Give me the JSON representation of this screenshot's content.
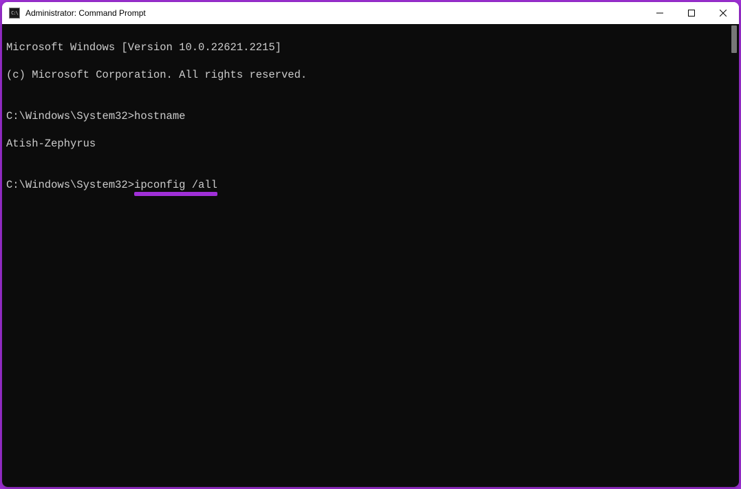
{
  "window": {
    "title": "Administrator: Command Prompt",
    "icon_text": "C:\\"
  },
  "terminal": {
    "lines": {
      "version": "Microsoft Windows [Version 10.0.22621.2215]",
      "copyright": "(c) Microsoft Corporation. All rights reserved.",
      "blank1": "",
      "prompt1_path": "C:\\Windows\\System32>",
      "prompt1_cmd": "hostname",
      "hostname_out": "Atish-Zephyrus",
      "blank2": "",
      "prompt2_path": "C:\\Windows\\System32>",
      "prompt2_cmd": "ipconfig /all"
    }
  },
  "colors": {
    "accent_border": "#a030d8",
    "terminal_bg": "#0c0c0c",
    "terminal_fg": "#cccccc"
  }
}
